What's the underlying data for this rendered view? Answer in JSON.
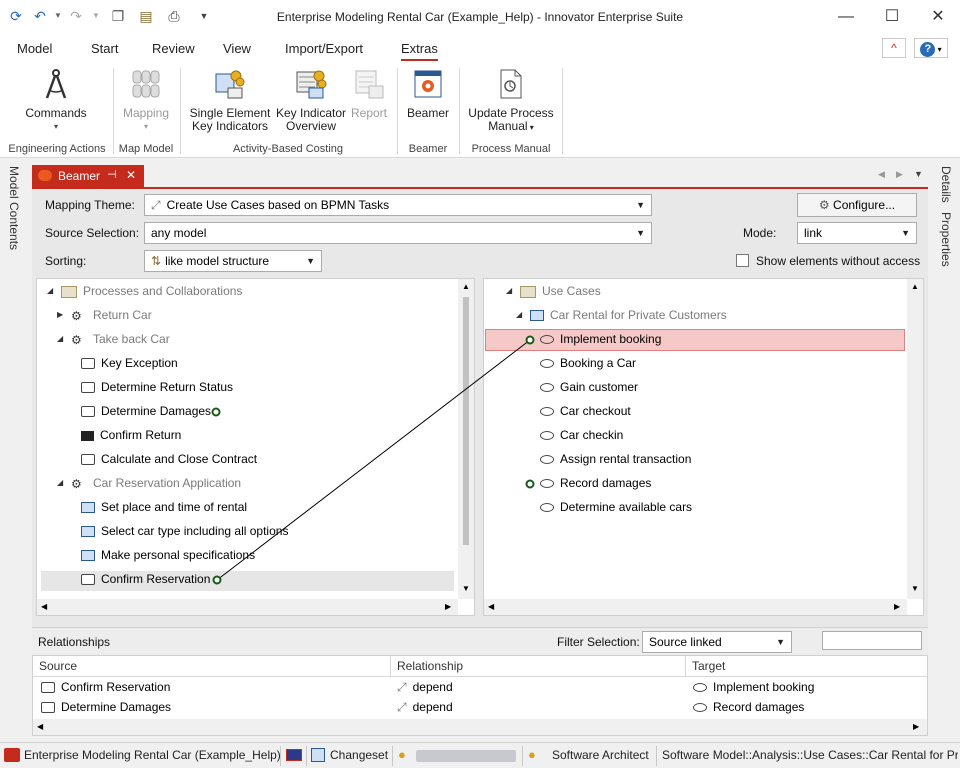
{
  "window": {
    "title": "Enterprise Modeling Rental Car (Example_Help) - Innovator Enterprise Suite",
    "controls": [
      "minimize",
      "maximize",
      "close"
    ]
  },
  "menu": {
    "items": [
      "Model",
      "Start",
      "Review",
      "View",
      "Import/Export",
      "Extras"
    ],
    "active": "Extras"
  },
  "ribbon": {
    "groups": [
      {
        "label": "Engineering Actions",
        "buttons": [
          {
            "label": "Commands"
          }
        ]
      },
      {
        "label": "Map Model",
        "buttons": [
          {
            "label": "Mapping"
          }
        ]
      },
      {
        "label": "Activity-Based Costing",
        "buttons": [
          {
            "label1": "Single Element",
            "label2": "Key Indicators"
          },
          {
            "label1": "Key Indicator",
            "label2": "Overview"
          },
          {
            "label": "Report"
          }
        ]
      },
      {
        "label": "Beamer",
        "buttons": [
          {
            "label": "Beamer"
          }
        ]
      },
      {
        "label": "Process Manual",
        "buttons": [
          {
            "label1": "Update Process",
            "label2": "Manual"
          }
        ]
      }
    ]
  },
  "side_tabs": {
    "left": "Model Contents",
    "right1": "Details",
    "right2": "Properties"
  },
  "beamer": {
    "tab_label": "Beamer",
    "mapping_theme_label": "Mapping Theme:",
    "mapping_theme_value": "Create Use Cases based on BPMN Tasks",
    "configure_label": "Configure...",
    "source_selection_label": "Source Selection:",
    "source_selection_value": "any model",
    "mode_label": "Mode:",
    "mode_value": "link",
    "sorting_label": "Sorting:",
    "sorting_value": "like model structure",
    "show_access_label": "Show elements without access"
  },
  "left_tree": [
    {
      "label": "Processes and Collaborations",
      "icon": "folder-icon",
      "gray": true
    },
    {
      "label": "Return Car",
      "icon": "process-icon",
      "gray": true
    },
    {
      "label": "Take back Car",
      "icon": "process-icon",
      "gray": true
    },
    {
      "label": "Key Exception",
      "icon": "task-icon"
    },
    {
      "label": "Determine Return Status",
      "icon": "task-icon"
    },
    {
      "label": "Determine Damages",
      "icon": "task-icon"
    },
    {
      "label": "Confirm Return",
      "icon": "send-task-icon"
    },
    {
      "label": "Calculate and Close Contract",
      "icon": "task-icon"
    },
    {
      "label": "Car Reservation Application",
      "icon": "process-icon",
      "gray": true
    },
    {
      "label": "Set place and time of rental",
      "icon": "manual-task-icon"
    },
    {
      "label": "Select car type including all options",
      "icon": "manual-task-icon"
    },
    {
      "label": "Make personal specifications",
      "icon": "manual-task-icon"
    },
    {
      "label": "Confirm Reservation",
      "icon": "task-icon"
    }
  ],
  "right_tree": [
    {
      "label": "Use Cases",
      "icon": "folder-icon",
      "gray": true
    },
    {
      "label": "Car Rental for Private Customers",
      "icon": "package-icon",
      "gray": true
    },
    {
      "label": "Implement booking",
      "icon": "use-case-icon",
      "selected": true
    },
    {
      "label": "Booking a Car",
      "icon": "use-case-icon"
    },
    {
      "label": "Gain customer",
      "icon": "use-case-icon"
    },
    {
      "label": "Car checkout",
      "icon": "use-case-icon"
    },
    {
      "label": "Car checkin",
      "icon": "use-case-icon"
    },
    {
      "label": "Assign rental transaction",
      "icon": "use-case-icon"
    },
    {
      "label": "Record damages",
      "icon": "use-case-icon"
    },
    {
      "label": "Determine available cars",
      "icon": "use-case-icon"
    }
  ],
  "relationships": {
    "title": "Relationships",
    "filter_label": "Filter Selection:",
    "filter_value": "Source linked",
    "filter_search": "",
    "columns": [
      "Source",
      "Relationship",
      "Target"
    ],
    "rows": [
      {
        "source": "Confirm Reservation",
        "relationship": "depend",
        "target": "Implement booking"
      },
      {
        "source": "Determine Damages",
        "relationship": "depend",
        "target": "Record damages"
      }
    ]
  },
  "status": {
    "model": "Enterprise Modeling Rental Car (Example_Help)",
    "changeset": "Changeset",
    "role": "Software Architect",
    "path": "Software Model::Analysis::Use Cases::Car Rental for Priv"
  },
  "colors": {
    "accent": "#c42b1c",
    "selection": "#f6c9c9",
    "link_line": "#000000"
  }
}
